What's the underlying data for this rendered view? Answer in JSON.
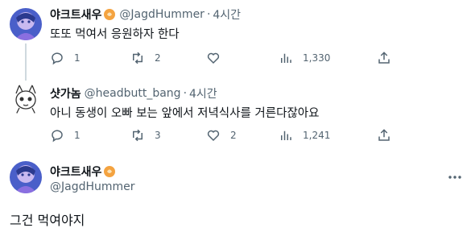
{
  "tweets": [
    {
      "name": "야크트새우",
      "handle": "@JagdHummer",
      "time": "4시간",
      "text": "또또 먹여서 응원하자 한다",
      "replies": "1",
      "retweets": "2",
      "likes": "",
      "views": "1,330"
    },
    {
      "name": "샷가놈",
      "handle": "@headbutt_bang",
      "time": "4시간",
      "text": "아니 동생이 오빠 보는 앞에서 저녁식사를 거른다잖아요",
      "replies": "1",
      "retweets": "3",
      "likes": "2",
      "views": "1,241"
    }
  ],
  "main_tweet": {
    "name": "야크트새우",
    "handle": "@JagdHummer",
    "text": "그건 먹여야지"
  },
  "dot_separator": "·",
  "colors": {
    "text_primary": "#0f1419",
    "text_secondary": "#536471",
    "thread_line": "#cfd9de",
    "avatar1_bg": "#5b6fd6",
    "emoji_orange": "#f4a340"
  },
  "icons": [
    "reply-icon",
    "retweet-icon",
    "like-icon",
    "views-icon",
    "share-icon",
    "more-icon",
    "emoji-icon"
  ]
}
